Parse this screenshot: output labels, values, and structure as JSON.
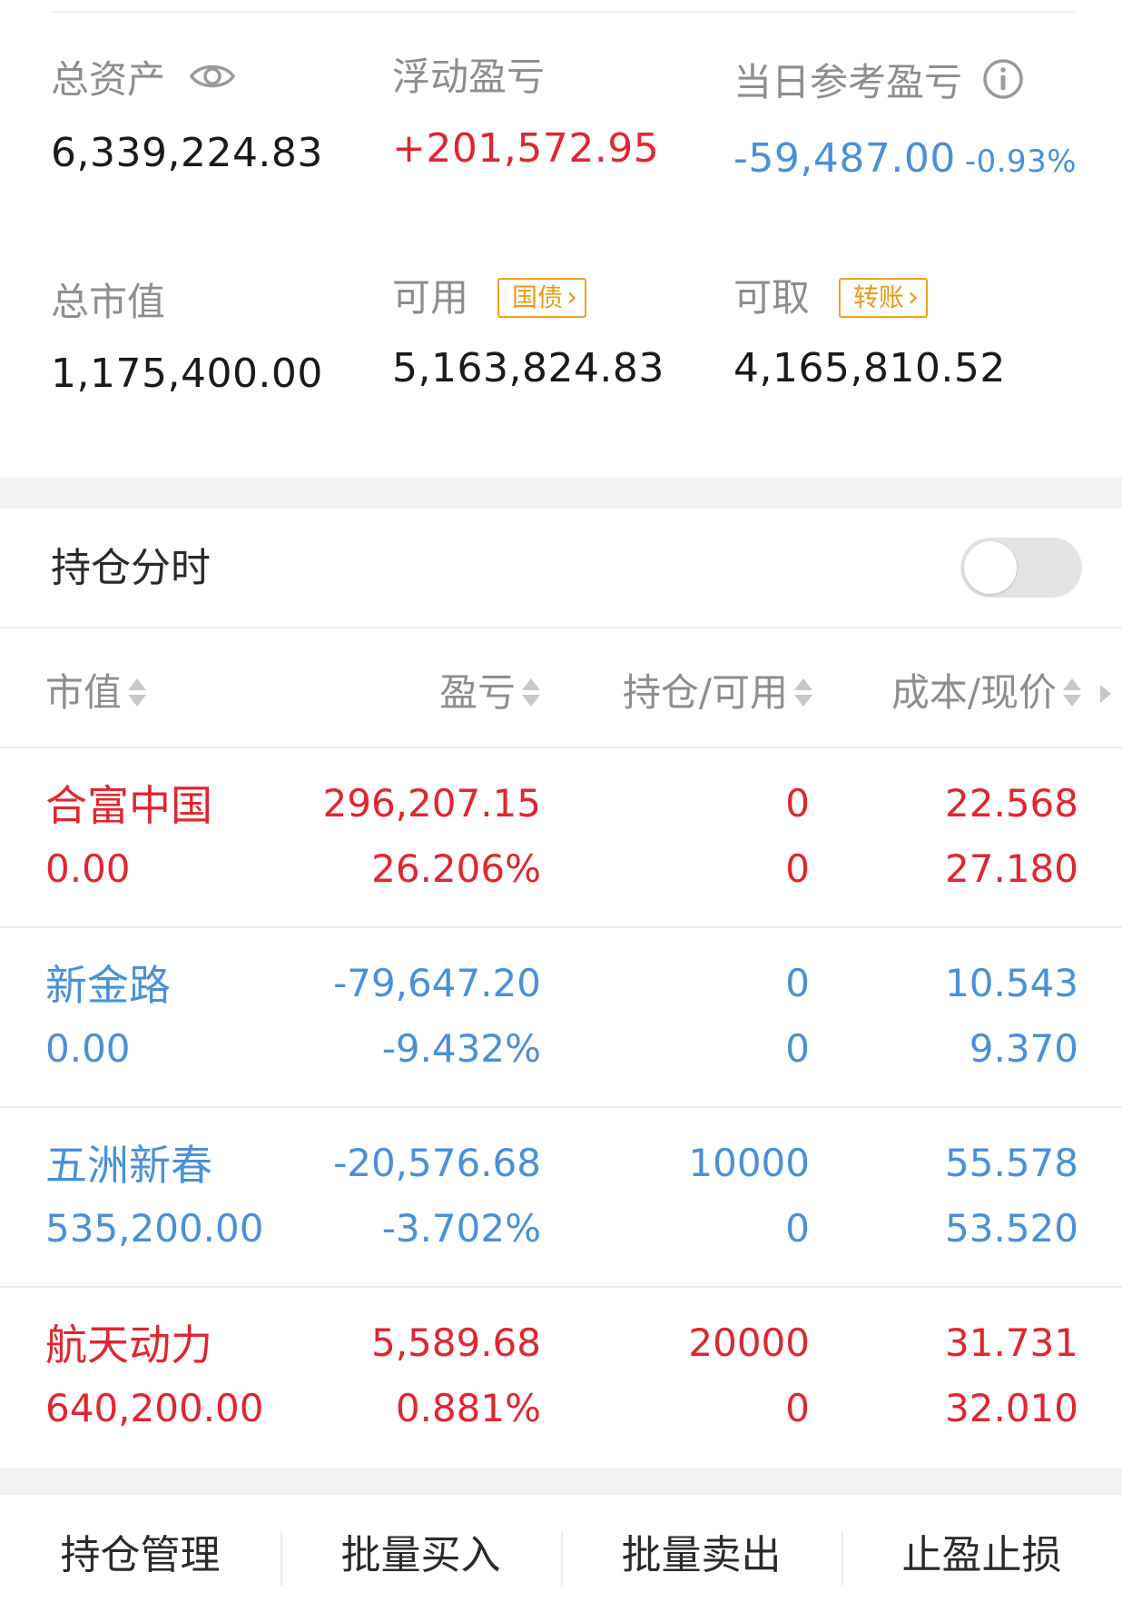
{
  "summary": {
    "total_assets": {
      "label": "总资产",
      "value": "6,339,224.83"
    },
    "floating_pl": {
      "label": "浮动盈亏",
      "value": "+201,572.95"
    },
    "daily_pl": {
      "label": "当日参考盈亏",
      "value": "-59,487.00",
      "pct": "-0.93%"
    },
    "market_value": {
      "label": "总市值",
      "value": "1,175,400.00"
    },
    "available": {
      "label": "可用",
      "value": "5,163,824.83",
      "tag": "国债"
    },
    "withdrawable": {
      "label": "可取",
      "value": "4,165,810.52",
      "tag": "转账"
    }
  },
  "toggle": {
    "label": "持仓分时",
    "on": false
  },
  "table": {
    "headers": [
      "市值",
      "盈亏",
      "持仓/可用",
      "成本/现价"
    ],
    "rows": [
      {
        "name": "合富中国",
        "market_value": "0.00",
        "pl": "296,207.15",
        "pl_pct": "26.206%",
        "position": "0",
        "available": "0",
        "cost": "22.568",
        "price": "27.180",
        "trend": "up"
      },
      {
        "name": "新金路",
        "market_value": "0.00",
        "pl": "-79,647.20",
        "pl_pct": "-9.432%",
        "position": "0",
        "available": "0",
        "cost": "10.543",
        "price": "9.370",
        "trend": "down"
      },
      {
        "name": "五洲新春",
        "market_value": "535,200.00",
        "pl": "-20,576.68",
        "pl_pct": "-3.702%",
        "position": "10000",
        "available": "0",
        "cost": "55.578",
        "price": "53.520",
        "trend": "down"
      },
      {
        "name": "航天动力",
        "market_value": "640,200.00",
        "pl": "5,589.68",
        "pl_pct": "0.881%",
        "position": "20000",
        "available": "0",
        "cost": "31.731",
        "price": "32.010",
        "trend": "up"
      }
    ]
  },
  "bottom_actions": [
    "持仓管理",
    "批量买入",
    "批量卖出",
    "止盈止损"
  ],
  "colors": {
    "up": "#e0262f",
    "down": "#4a90d9",
    "accent_tag": "#f0a020"
  }
}
